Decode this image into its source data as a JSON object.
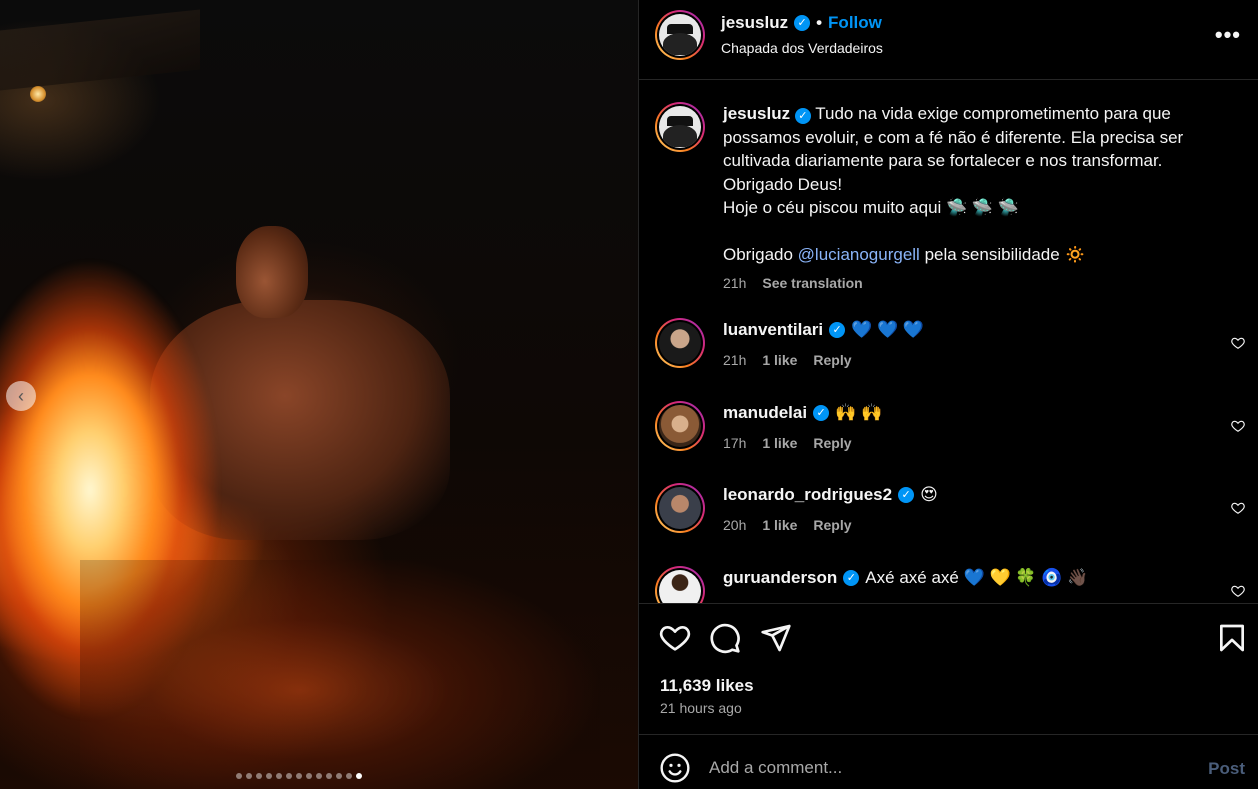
{
  "post": {
    "username": "jesusluz",
    "follow_label": "Follow",
    "bullet": "•",
    "location": "Chapada dos Verdadeiros",
    "more_label": "•••",
    "caption": {
      "text": "Tudo na vida exige comprometimento para que possamos evoluir, e com a fé não é diferente. Ela precisa ser cultivada diariamente para se fortalecer e nos transformar.\nObrigado Deus!\nHoje o céu piscou muito aqui 🛸 🛸 🛸\n\nObrigado ",
      "mention": "@lucianogurgell",
      "text_after": " pela sensibilidade 🔅",
      "time": "21h",
      "translate_label": "See translation"
    },
    "likes": "11,639 likes",
    "posted": "21 hours ago"
  },
  "comments": [
    {
      "username": "luanventilari",
      "text": "💙 💙 💙",
      "time": "21h",
      "likes": "1 like",
      "reply": "Reply"
    },
    {
      "username": "manudelai",
      "text": "🙌 🙌",
      "time": "17h",
      "likes": "1 like",
      "reply": "Reply"
    },
    {
      "username": "leonardo_rodrigues2",
      "text": "😍",
      "time": "20h",
      "likes": "1 like",
      "reply": "Reply"
    },
    {
      "username": "guruanderson",
      "text": "Axé axé axé 💙 💛 🍀 🧿 👋🏿",
      "time": "",
      "likes": "",
      "reply": ""
    }
  ],
  "add_comment": {
    "placeholder": "Add a comment...",
    "post_label": "Post"
  },
  "carousel": {
    "total_slides": 13,
    "active_index": 12
  },
  "colors": {
    "accent": "#0095f6",
    "background": "#000000",
    "muted": "#a8a8a8"
  }
}
